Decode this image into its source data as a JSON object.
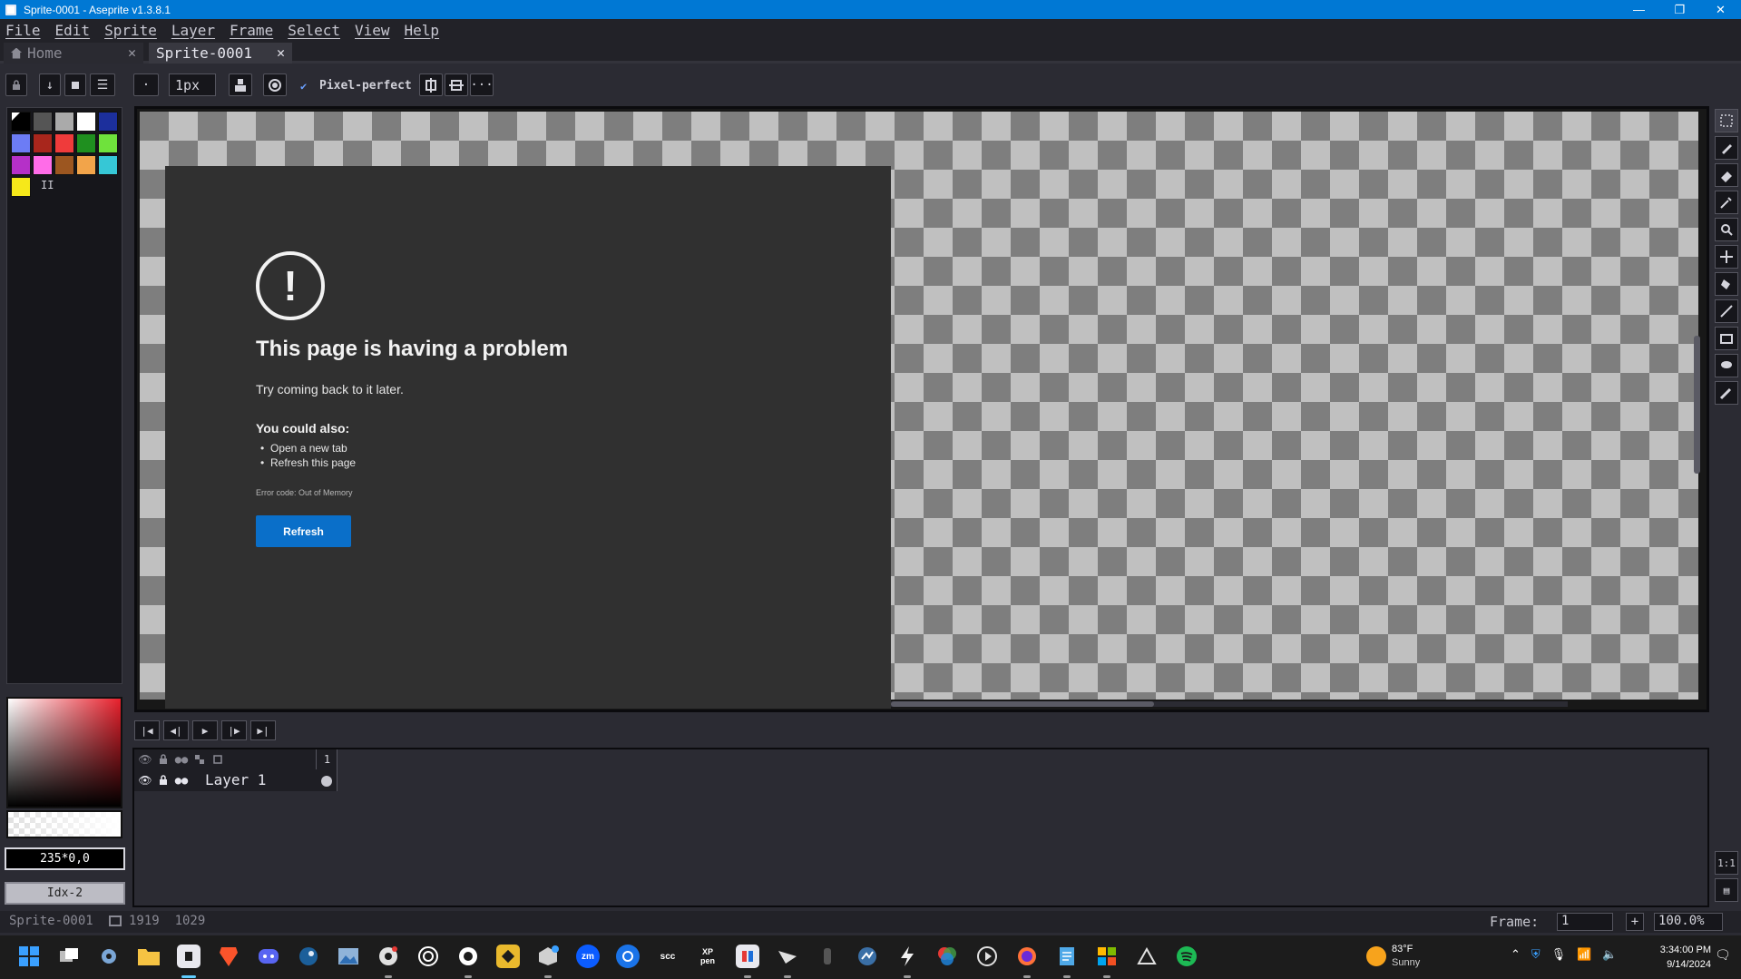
{
  "window": {
    "title": "Sprite-0001 - Aseprite v1.3.8.1",
    "minimize": "—",
    "maximize": "❐",
    "close": "✕"
  },
  "menu": [
    "File",
    "Edit",
    "Sprite",
    "Layer",
    "Frame",
    "Select",
    "View",
    "Help"
  ],
  "tabs": {
    "home": "Home",
    "sprite": "Sprite-0001",
    "close_glyph": "✕"
  },
  "toolbar": {
    "brush_size": "1px",
    "pixel_perfect_label": "Pixel-perfect",
    "pixel_perfect_checked": true,
    "more_glyph": "···"
  },
  "palette": {
    "colors": [
      "#000000",
      "#555555",
      "#aaaaaa",
      "#ffffff",
      "#1c2f9c",
      "#6c7cf5",
      "#a8261c",
      "#ef3b3b",
      "#1f8f1f",
      "#6fe23c",
      "#b530c8",
      "#ff6ce8",
      "#9c5620",
      "#f2a44a",
      "#36c7d6",
      "#f6e81a"
    ],
    "more_label": "II"
  },
  "color": {
    "readout": "235*0,0",
    "index": "Idx-2"
  },
  "browser_error": {
    "icon_glyph": "!",
    "title": "This page is having a problem",
    "subtitle": "Try coming back to it later.",
    "also_heading": "You could also:",
    "options": [
      "Open a new tab",
      "Refresh this page"
    ],
    "error_code": "Error code: Out of Memory",
    "refresh_button": "Refresh"
  },
  "timeline": {
    "frame_header": "1",
    "layer_name": "Layer 1"
  },
  "status": {
    "sprite_name": "Sprite-0001",
    "dimensions": "1919  1029",
    "frame_label": "Frame:",
    "frame_value": "1",
    "plus": "+",
    "zoom": "100.0%"
  },
  "taskbar": {
    "weather_temp": "83°F",
    "weather_condition": "Sunny",
    "time": "3:34:00 PM",
    "date": "9/14/2024",
    "apps": [
      "Start",
      "Task View",
      "Settings",
      "File Explorer",
      "Aseprite",
      "Brave",
      "Discord",
      "Steam",
      "Photos",
      "Chrome",
      "App",
      "App",
      "App",
      "App",
      "Zoom",
      "App",
      "scc",
      "XP-Pen",
      "App",
      "App",
      "App",
      "App",
      "App",
      "App",
      "App",
      "App",
      "Firefox",
      "Notepad",
      "App",
      "App",
      "Spotify"
    ],
    "labels": {
      "zoom": "zm",
      "scc": "scc",
      "xppen": "XP pen"
    }
  }
}
